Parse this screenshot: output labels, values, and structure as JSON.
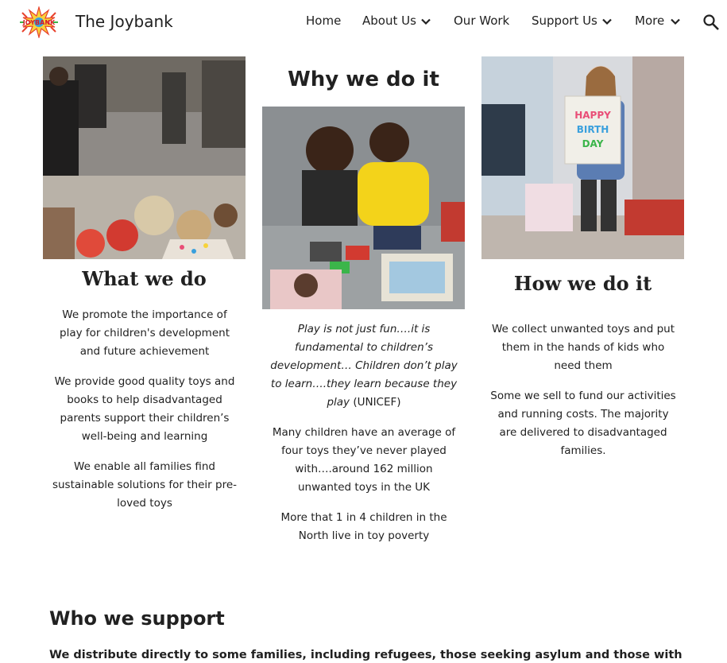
{
  "header": {
    "site_title": "The Joybank",
    "logo_text": "JOYBANK",
    "nav": [
      {
        "label": "Home",
        "has_dropdown": false
      },
      {
        "label": "About Us",
        "has_dropdown": true
      },
      {
        "label": "Our Work",
        "has_dropdown": false
      },
      {
        "label": "Support Us",
        "has_dropdown": true
      },
      {
        "label": "More",
        "has_dropdown": true
      }
    ],
    "search_icon": "search-icon"
  },
  "columns": {
    "what": {
      "heading": "What we do",
      "paragraphs": [
        "We promote the importance of play for children's development and future achievement",
        "We provide good quality toys and books to help disadvantaged parents support their children’s well-being and learning",
        "We enable all families find sustainable solutions for their pre-loved toys"
      ]
    },
    "why": {
      "heading": "Why we do it",
      "quote": "Play is not just fun….it is fundamental to children’s development…  Children don’t play to learn….they learn because  they play",
      "quote_source": "(UNICEF)",
      "paragraphs": [
        "Many children have an average of four toys they’ve never played with….around 162 million unwanted toys in the UK",
        "More that 1 in 4 children in the North live in toy poverty"
      ]
    },
    "how": {
      "heading": "How we do it",
      "paragraphs": [
        "We collect unwanted  toys and put them in the hands of kids who  need them",
        "Some we sell to fund our activities  and running costs.  The  majority are delivered  to disadvantaged families."
      ]
    }
  },
  "who": {
    "heading": "Who we support",
    "text": "We distribute directly to some families, including refugees, those seeking asylum and those with"
  },
  "colors": {
    "text": "#212121",
    "background": "#ffffff"
  }
}
